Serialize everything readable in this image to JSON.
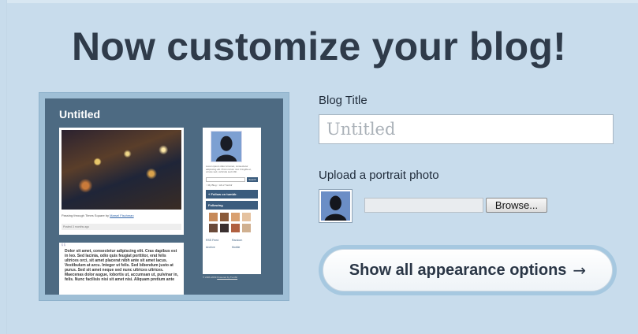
{
  "heading": "Now customize your blog!",
  "preview": {
    "blog_title": "Untitled",
    "photo_caption": "Passing through Times Square by",
    "photo_caption_link": "Marsel Fischman",
    "posted": "Posted 3 months ago",
    "quote_text": "Dolor sit amet, consectetur adipiscing elit. Cras dapibus est in leo. Sed lacinia, odio quis feugiat porttitor, erat felis ultrices orci, sit amet placerat nibh ante sit amet lacus. Vestibulum at arcu. Integer ut felis. Sed bibendum justo at purus. Sed sit amet neque sed nunc ultrices ultrices. Maecenas dolor augue, lobortis ut, accumsan ut, pulvinar in, felis. Nunc facilisis nisi sit amet nisi. Aliquam pretium ante",
    "side_desc": "Lorem ipsum dolor sit amet, consectetur adipiscing elit. Proin rutrum nisl. Fringilla et, ornare sed, vehicula sed nibh.",
    "search_label": "Search",
    "radio_my_blog": "My Blog",
    "radio_all": "All of Tumblr",
    "follow_label": "Follow on tumblr.",
    "following_label": "Following",
    "links": [
      "RSS Feed",
      "Random",
      "Archive",
      "Mobile"
    ],
    "footer": "© 2006-2009",
    "footer_link": "Powered by Tumblr"
  },
  "form": {
    "blog_title_label": "Blog Title",
    "blog_title_placeholder": "Untitled",
    "upload_label": "Upload a portrait photo",
    "browse_label": "Browse...",
    "show_options_label": "Show all appearance options",
    "show_options_arrow": "→"
  },
  "colors": {
    "background": "#c8dcec",
    "heading": "#2f3b4a",
    "preview_bg": "#4d6a82",
    "avatar_blue": "#6b8ec6"
  }
}
